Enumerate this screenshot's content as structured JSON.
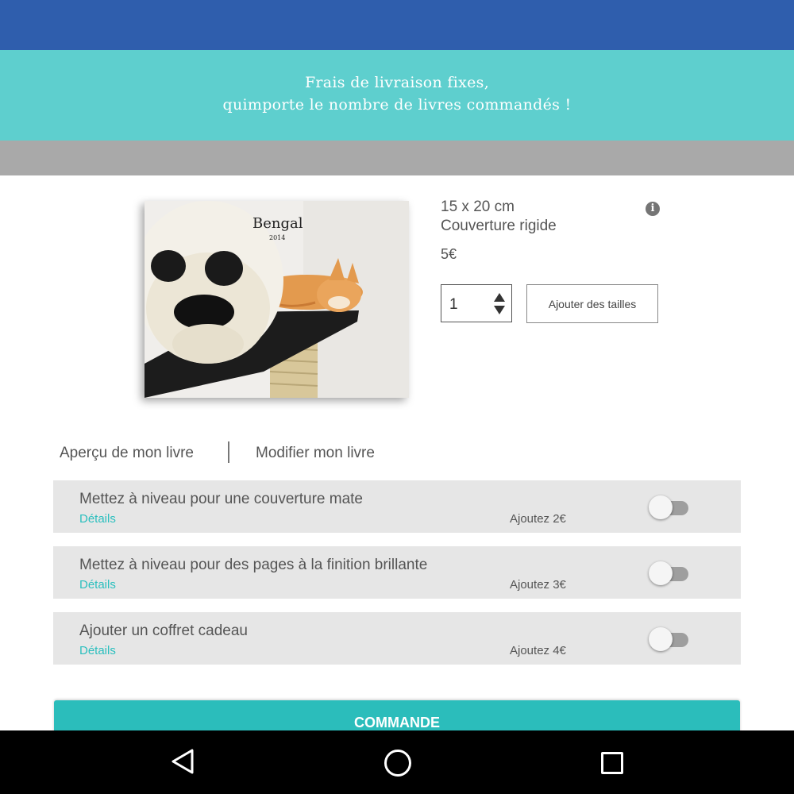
{
  "banner": {
    "line1": "Frais de livraison fixes,",
    "line2": "quimporte le nombre de livres commandés !"
  },
  "book": {
    "cover_title": "Bengal",
    "cover_year": "2014"
  },
  "product": {
    "size": "15 x 20 cm",
    "cover": "Couverture rigide",
    "price": "5€",
    "info_icon": "info-icon"
  },
  "quantity": {
    "value": "1"
  },
  "add_sizes_label": "Ajouter des tailles",
  "links": {
    "preview": "Aperçu de mon livre",
    "modify": "Modifier mon livre"
  },
  "options": [
    {
      "title": "Mettez à niveau pour une couverture mate",
      "details": "Détails",
      "price": "Ajoutez 2€",
      "enabled": false
    },
    {
      "title": "Mettez à niveau pour des pages à la finition brillante",
      "details": "Détails",
      "price": "Ajoutez 3€",
      "enabled": false
    },
    {
      "title": "Ajouter un coffret cadeau",
      "details": "Détails",
      "price": "Ajoutez 4€",
      "enabled": false
    }
  ],
  "order_button_label": "COMMANDE",
  "colors": {
    "top_bar": "#2f5ead",
    "banner": "#5ecfce",
    "accent": "#2bbdbb",
    "details_link": "#2abfbe"
  },
  "nav": {
    "back": "back-icon",
    "home": "home-icon",
    "recents": "recents-icon"
  }
}
